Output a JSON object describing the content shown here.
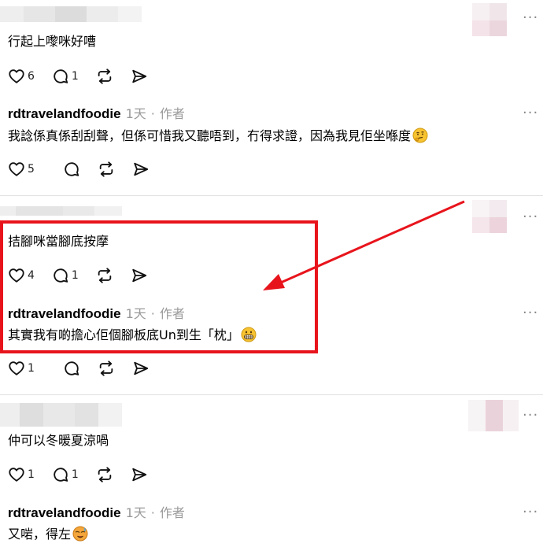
{
  "thread": [
    {
      "comment_text": "行起上嚟咪好嘈",
      "likes": "6",
      "replies": "1",
      "reply": {
        "author": "rdtravelandfoodie",
        "time": "1天",
        "role": "作者",
        "text": "我諗係真係刮刮聲，但係可惜我又聽唔到，冇得求證，因為我見佢坐喺度",
        "emoji": "thinking-face-emoji",
        "likes": "5"
      }
    },
    {
      "comment_text": "拮腳咪當腳底按摩",
      "likes": "4",
      "replies": "1",
      "reply": {
        "author": "rdtravelandfoodie",
        "time": "1天",
        "role": "作者",
        "text": "其實我有啲擔心佢個腳板底Un到生「枕」",
        "emoji": "grimacing-face-emoji",
        "likes": "1"
      }
    },
    {
      "comment_text": "仲可以冬暖夏涼喎",
      "likes": "1",
      "replies": "1",
      "reply": {
        "author": "rdtravelandfoodie",
        "time": "1天",
        "role": "作者",
        "text": "又啱，得左",
        "emoji": "hot-face-emoji"
      }
    }
  ],
  "icons": {
    "like": "heart-icon",
    "reply": "speech-bubble-icon",
    "repost": "repost-icon",
    "share": "send-icon",
    "more": "more-options-icon"
  },
  "more_glyph": "···",
  "colors": {
    "annotation": "#e8141c",
    "meta": "#999999",
    "divider": "#e2e2e2"
  }
}
